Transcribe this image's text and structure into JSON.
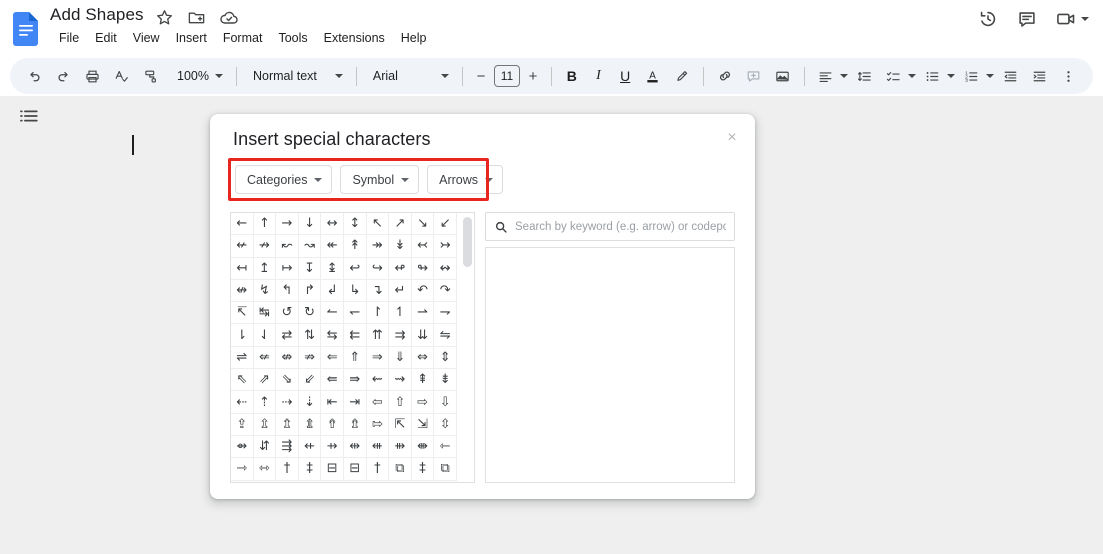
{
  "app": {
    "name": "Google Docs",
    "logo_color": "#4285F4",
    "document_title": "Add Shapes",
    "title_icons": [
      {
        "name": "star-icon",
        "label": "Star"
      },
      {
        "name": "move-to-folder-icon",
        "label": "Move"
      },
      {
        "name": "cloud-saved-icon",
        "label": "Saved to Drive"
      }
    ],
    "menus": [
      "File",
      "Edit",
      "View",
      "Insert",
      "Format",
      "Tools",
      "Extensions",
      "Help"
    ],
    "top_right_icons": [
      {
        "name": "version-history-icon",
        "label": "Version history"
      },
      {
        "name": "comment-icon",
        "label": "Open comment history"
      },
      {
        "name": "meet-camera-icon",
        "label": "Join a call"
      }
    ]
  },
  "toolbar": {
    "undo": "Undo",
    "redo": "Redo",
    "print": "Print",
    "spelling": "Spelling and grammar check",
    "paint_format": "Paint format",
    "zoom_value": "100%",
    "style_value": "Normal text",
    "font_value": "Arial",
    "font_size_minus": "−",
    "font_size_value": "11",
    "font_size_plus": "+",
    "bold": "B",
    "italic": "I",
    "underline": "U",
    "text_color": "A",
    "highlight_color": "Highlight color",
    "insert_link": "Insert link",
    "add_comment": "Add comment",
    "insert_image": "Insert image",
    "align": "Align",
    "line_spacing": "Line & paragraph spacing",
    "checklist": "Checklist",
    "bulleted_list": "Bulleted list",
    "numbered_list": "Numbered list",
    "decrease_indent": "Decrease indent",
    "increase_indent": "Increase indent",
    "more_options": "More"
  },
  "canvas": {
    "outline_icon": "show-document-outline",
    "background_color": "#efefef"
  },
  "dialog": {
    "title": "Insert special characters",
    "close_label": "×",
    "highlight_color": "#e8251f",
    "dropdowns": [
      {
        "name": "categories-dropdown",
        "label": "Categories"
      },
      {
        "name": "symbol-dropdown",
        "label": "Symbol"
      },
      {
        "name": "arrows-dropdown",
        "label": "Arrows"
      }
    ],
    "search": {
      "placeholder": "Search by keyword (e.g. arrow) or codepoint",
      "value": "",
      "icon": "search-icon"
    },
    "results_panel": {
      "name": "character-preview-panel",
      "content": ""
    },
    "grid": {
      "columns": 10,
      "scroll_position": "top",
      "characters": [
        "←",
        "↑",
        "→",
        "↓",
        "↔",
        "↕",
        "↖",
        "↗",
        "↘",
        "↙",
        "↚",
        "↛",
        "↜",
        "↝",
        "↞",
        "↟",
        "↠",
        "↡",
        "↢",
        "↣",
        "↤",
        "↥",
        "↦",
        "↧",
        "↨",
        "↩",
        "↪",
        "↫",
        "↬",
        "↭",
        "↮",
        "↯",
        "↰",
        "↱",
        "↲",
        "↳",
        "↴",
        "↵",
        "↶",
        "↷",
        "↸",
        "↹",
        "↺",
        "↻",
        "↼",
        "↽",
        "↾",
        "↿",
        "⇀",
        "⇁",
        "⇂",
        "⇃",
        "⇄",
        "⇅",
        "⇆",
        "⇇",
        "⇈",
        "⇉",
        "⇊",
        "⇋",
        "⇌",
        "⇍",
        "⇎",
        "⇏",
        "⇐",
        "⇑",
        "⇒",
        "⇓",
        "⇔",
        "⇕",
        "⇖",
        "⇗",
        "⇘",
        "⇙",
        "⇚",
        "⇛",
        "⇜",
        "⇝",
        "⇞",
        "⇟",
        "⇠",
        "⇡",
        "⇢",
        "⇣",
        "⇤",
        "⇥",
        "⇦",
        "⇧",
        "⇨",
        "⇩",
        "⇪",
        "⇫",
        "⇬",
        "⇭",
        "⇮",
        "⇯",
        "⇰",
        "⇱",
        "⇲",
        "⇳",
        "⇴",
        "⇵",
        "⇶",
        "⇷",
        "⇸",
        "⇹",
        "⇺",
        "⇻",
        "⇼",
        "⇽",
        "⇾",
        "⇿",
        "†",
        "‡",
        "⊟",
        "⊟",
        "†",
        "⧉",
        "‡",
        "⧉"
      ]
    }
  }
}
